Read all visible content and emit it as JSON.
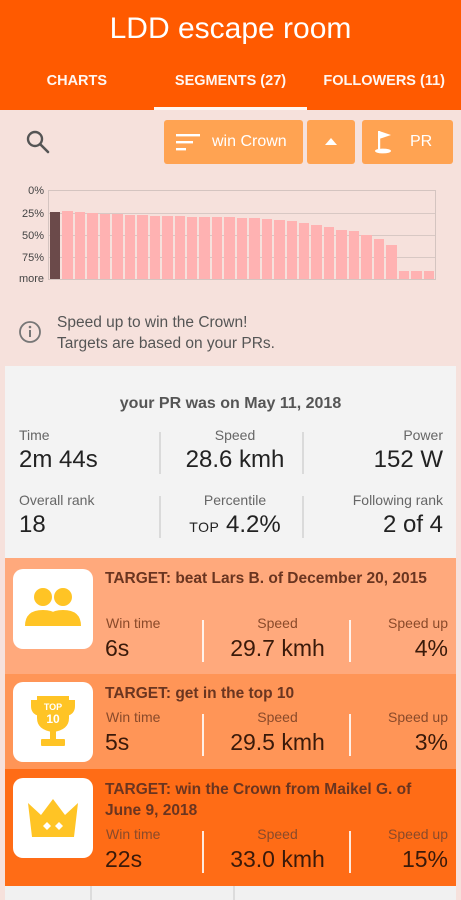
{
  "header": {
    "title": "LDD escape room",
    "tabs": [
      {
        "label": "CHARTS"
      },
      {
        "label": "SEGMENTS (27)"
      },
      {
        "label": "FOLLOWERS (11)"
      }
    ]
  },
  "filter": {
    "search_icon": "search-icon",
    "sort_button": {
      "label": "win Crown",
      "icon": "sort-lines-icon"
    },
    "order_button": {
      "icon": "triangle-up-icon"
    },
    "pr_button": {
      "label": "PR",
      "icon": "golf-flag-icon"
    },
    "histogram": {
      "y_labels": [
        "0%",
        "25%",
        "50%",
        "75%",
        "more"
      ],
      "bar_values": [
        0.76,
        0.77,
        0.76,
        0.75,
        0.74,
        0.74,
        0.73,
        0.73,
        0.72,
        0.72,
        0.72,
        0.71,
        0.71,
        0.7,
        0.7,
        0.69,
        0.69,
        0.68,
        0.67,
        0.66,
        0.64,
        0.61,
        0.59,
        0.56,
        0.54,
        0.5,
        0.45,
        0.39,
        0.09,
        0.09,
        0.09
      ],
      "highlight_index": 0,
      "colors": {
        "bar": "#ffb2b2",
        "highlight": "#6b4a4a"
      }
    },
    "info": {
      "line1": "Speed up to win the Crown!",
      "line2": "Targets are based on your PRs."
    }
  },
  "pr": {
    "title": "your PR was on May 11, 2018",
    "time": {
      "label": "Time",
      "value": "2m 44s"
    },
    "speed": {
      "label": "Speed",
      "value": "28.6 kmh"
    },
    "power": {
      "label": "Power",
      "value": "152 W"
    },
    "overall_rank": {
      "label": "Overall rank",
      "value": "18"
    },
    "percentile": {
      "label": "Percentile",
      "prefix": "TOP",
      "value": "4.2%"
    },
    "following_rank": {
      "label": "Following rank",
      "value": "2 of 4"
    }
  },
  "targets": [
    {
      "title": "TARGET: beat Lars B. of December 20, 2015",
      "icon": "two-people-icon",
      "win_time_label": "Win time",
      "win_time": "6s",
      "speed_label": "Speed",
      "speed": "29.7 kmh",
      "speed_up_label": "Speed up",
      "speed_up": "4%"
    },
    {
      "title": "TARGET: get in the top 10",
      "icon": "top-10-trophy-icon",
      "icon_text": "TOP 10",
      "win_time_label": "Win time",
      "win_time": "5s",
      "speed_label": "Speed",
      "speed": "29.5 kmh",
      "speed_up_label": "Speed up",
      "speed_up": "3%"
    },
    {
      "title": "TARGET: win the Crown from Maikel G. of June 9, 2018",
      "icon": "crown-icon",
      "win_time_label": "Win time",
      "win_time": "22s",
      "speed_label": "Speed",
      "speed": "33.0 kmh",
      "speed_up_label": "Speed up",
      "speed_up": "15%"
    }
  ],
  "colors": {
    "accent": "#ff5a00",
    "button": "#ffa352",
    "target1": "#ffa97c",
    "target2": "#ff9557",
    "target3": "#ff6c16",
    "icon_yellow": "#ffc425"
  }
}
